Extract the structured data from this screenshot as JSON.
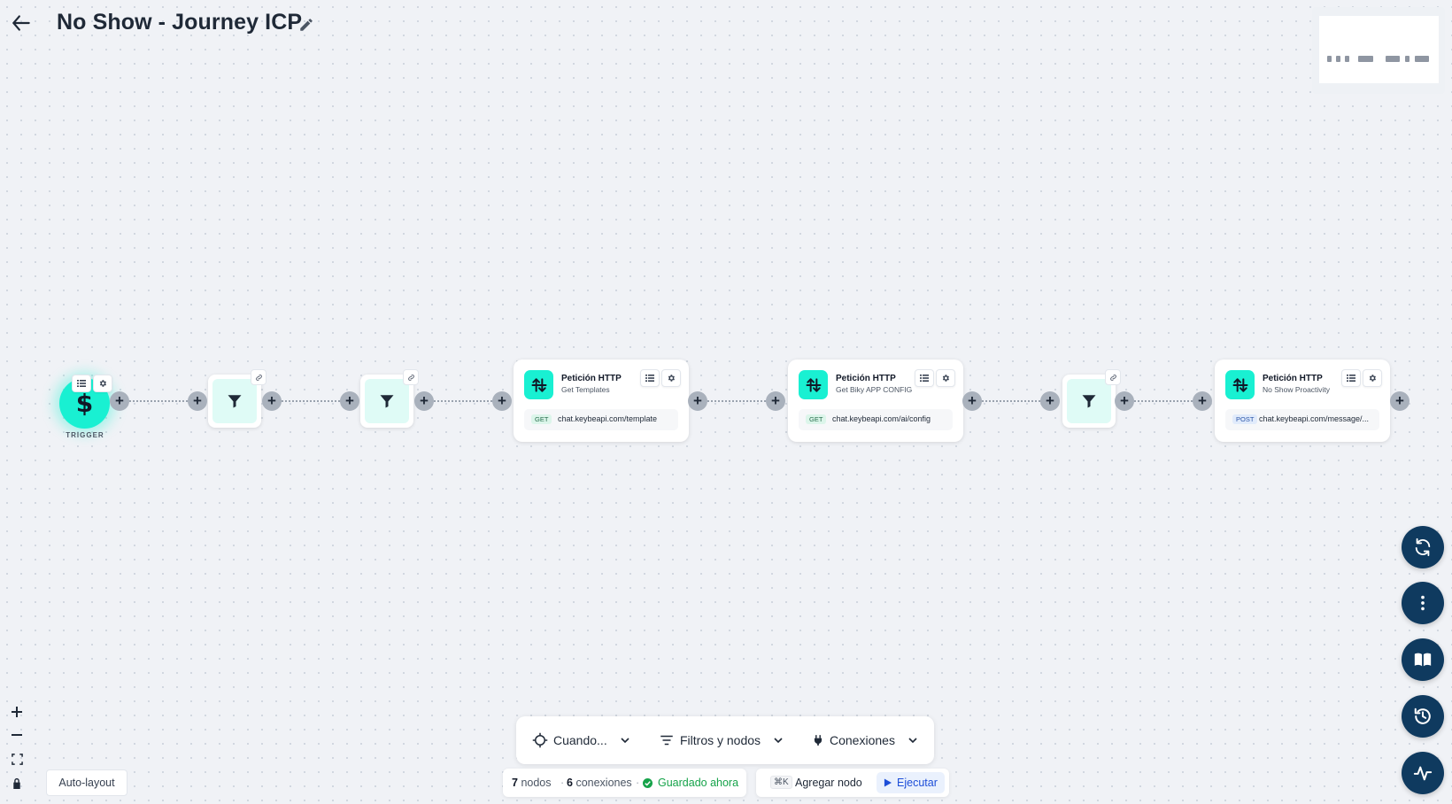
{
  "header": {
    "title": "No Show - Journey ICP",
    "back_icon": "arrow-left-icon",
    "edit_icon": "pencil-icon"
  },
  "trigger": {
    "label": "TRIGGER",
    "symbol": "$",
    "color": "#19f0d2"
  },
  "nodes": [
    {
      "title": "Petición HTTP",
      "subtitle": "Get Templates",
      "method": "GET",
      "url": "chat.keybeapi.com/template"
    },
    {
      "title": "Petición HTTP",
      "subtitle": "Get Biky APP CONFIG",
      "method": "GET",
      "url": "chat.keybeapi.com/ai/config"
    },
    {
      "title": "Petición HTTP",
      "subtitle": "No Show Proactivity",
      "method": "POST",
      "url": "chat.keybeapi.com/message/..."
    }
  ],
  "toolbar": {
    "when_label": "Cuando...",
    "filters_label": "Filtros y nodos",
    "connections_label": "Conexiones"
  },
  "stats": {
    "nodes_count": "7",
    "nodes_label": "nodos",
    "connections_count": "6",
    "connections_label": "conexiones",
    "saved_label": "Guardado ahora"
  },
  "actions": {
    "shortcut": "⌘K",
    "add_node_label": "Agregar nodo",
    "run_label": "Ejecutar"
  },
  "canvas_controls": {
    "auto_layout_label": "Auto-layout"
  },
  "colors": {
    "accent": "#19f0d2",
    "fab": "#0f3a5f",
    "saved": "#16a34a",
    "run": "#1d4ed8"
  }
}
